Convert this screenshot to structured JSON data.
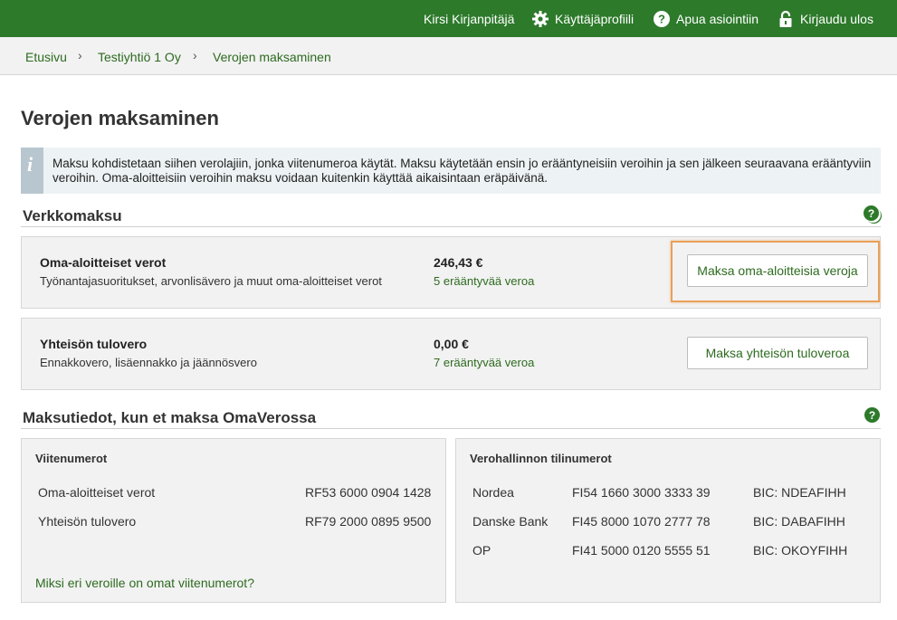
{
  "topbar": {
    "user": "Kirsi Kirjanpitäjä",
    "profile": "Käyttäjäprofiili",
    "help": "Apua asiointiin",
    "logout": "Kirjaudu ulos"
  },
  "breadcrumb": [
    "Etusivu",
    "Testiyhtiö 1 Oy",
    "Verojen maksaminen"
  ],
  "page_title": "Verojen maksaminen",
  "info_text": "Maksu kohdistetaan siihen verolajiin, jonka viitenumeroa käytät. Maksu käytetään ensin jo erääntyneisiin veroihin ja sen jälkeen seuraavana erääntyviin veroihin. Oma-aloitteisiin veroihin maksu voidaan kuitenkin käyttää aikaisintaan eräpäivänä.",
  "verkkomaksu": {
    "title": "Verkkomaksu",
    "items": [
      {
        "title": "Oma-aloitteiset verot",
        "subtitle": "Työnantajasuoritukset, arvonlisävero ja muut oma-aloitteiset verot",
        "amount": "246,43 €",
        "due": "5 erääntyvää veroa",
        "button": "Maksa oma-aloitteisia veroja"
      },
      {
        "title": "Yhteisön tulovero",
        "subtitle": "Ennakkovero, lisäennakko ja jäännösvero",
        "amount": "0,00 €",
        "due": "7 erääntyvää veroa",
        "button": "Maksa yhteisön tuloveroa"
      }
    ]
  },
  "maksutiedot": {
    "title": "Maksutiedot, kun et maksa OmaVerossa",
    "viitenumerot": {
      "header": "Viitenumerot",
      "rows": [
        {
          "label": "Oma-aloitteiset verot",
          "value": "RF53 6000 0904 1428"
        },
        {
          "label": "Yhteisön tulovero",
          "value": "RF79 2000 0895 9500"
        }
      ],
      "link": "Miksi eri veroille on omat viitenumerot?"
    },
    "tilinumerot": {
      "header": "Verohallinnon tilinumerot",
      "rows": [
        {
          "bank": "Nordea",
          "iban": "FI54 1660 3000 3333 39",
          "bic": "BIC: NDEAFIHH"
        },
        {
          "bank": "Danske Bank",
          "iban": "FI45 8000 1070 2777 78",
          "bic": "BIC: DABAFIHH"
        },
        {
          "bank": "OP",
          "iban": "FI41 5000 0120 5555 51",
          "bic": "BIC: OKOYFIHH"
        }
      ]
    }
  },
  "help_icon_text": "?",
  "info_icon_text": "i",
  "colors": {
    "brand_green": "#2d7a2b",
    "link_green": "#2d6b1f",
    "highlight": "#e8a15a"
  }
}
